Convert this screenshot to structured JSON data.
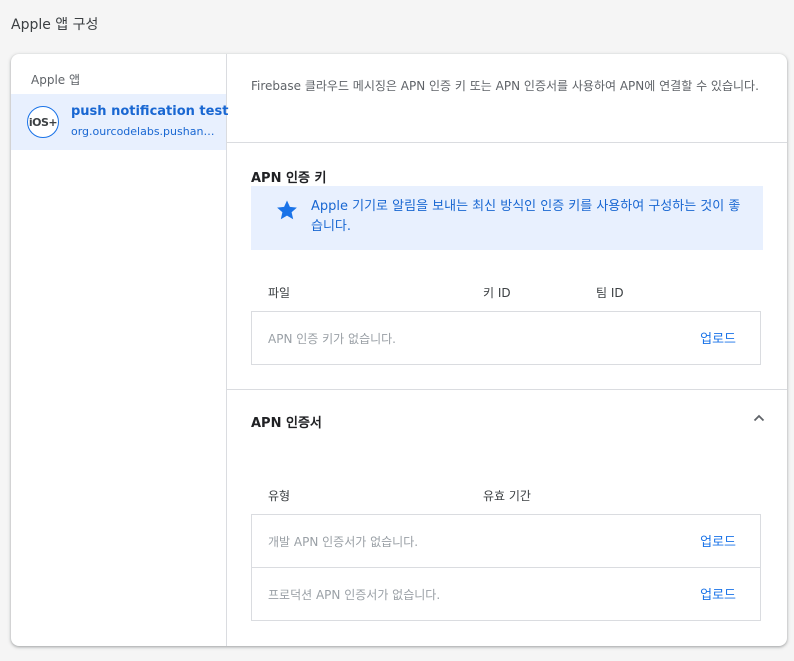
{
  "page": {
    "title": "Apple 앱 구성"
  },
  "sidebar": {
    "heading": "Apple 앱",
    "apps": [
      {
        "icon_label": "iOS+",
        "icon": "ios-icon",
        "name": "push notification test",
        "bundle_id": "org.ourcodelabs.pushandroid"
      }
    ]
  },
  "main": {
    "intro": "Firebase 클라우드 메시징은 APN 인증 키 또는 APN 인증서를 사용하여 APN에 연결할 수 있습니다.",
    "auth_key": {
      "title": "APN 인증 키",
      "tip_icon": "star-icon",
      "tip_text": "Apple 기기로 알림을 보내는 최신 방식인 인증 키를 사용하여 구성하는 것이 좋습니다.",
      "columns": [
        "파일",
        "키 ID",
        "팀 ID"
      ],
      "rows": [
        {
          "empty_text": "APN 인증 키가 없습니다.",
          "action": "업로드"
        }
      ]
    },
    "certificates": {
      "title": "APN 인증서",
      "collapse_icon": "chevron-up-icon",
      "columns": [
        "유형",
        "유효 기간"
      ],
      "rows": [
        {
          "empty_text": "개발 APN 인증서가 없습니다.",
          "action": "업로드"
        },
        {
          "empty_text": "프로덕션 APN 인증서가 없습니다.",
          "action": "업로드"
        }
      ]
    }
  },
  "colors": {
    "accent": "#1a73e8",
    "selected_bg": "#e8f0fe",
    "divider": "#dadce0"
  }
}
